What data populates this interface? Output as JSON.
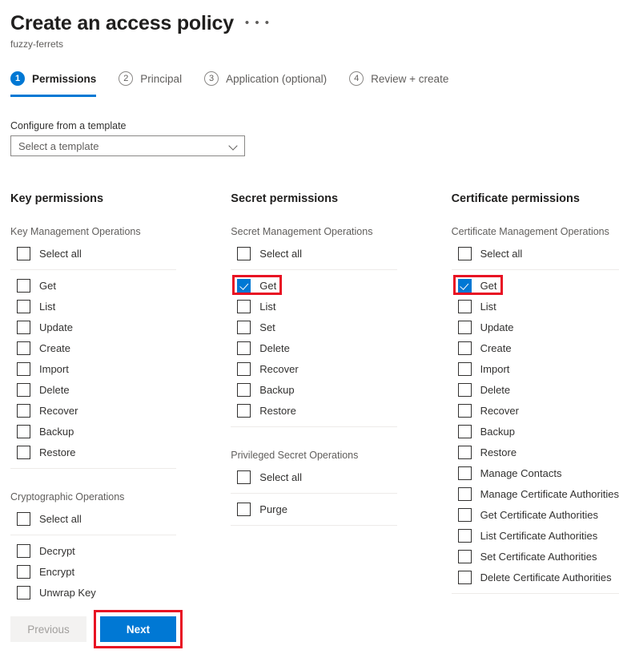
{
  "header": {
    "title": "Create an access policy",
    "subtitle": "fuzzy-ferrets",
    "more_menu": "• • •"
  },
  "tabs": [
    {
      "num": "1",
      "label": "Permissions",
      "active": true
    },
    {
      "num": "2",
      "label": "Principal",
      "active": false
    },
    {
      "num": "3",
      "label": "Application (optional)",
      "active": false
    },
    {
      "num": "4",
      "label": "Review + create",
      "active": false
    }
  ],
  "template": {
    "label": "Configure from a template",
    "selected": "Select a template",
    "chevron": "chevron-down-icon"
  },
  "columns": [
    {
      "title": "Key permissions",
      "groups": [
        {
          "title": "Key Management Operations",
          "select_all": "Select all",
          "items": [
            {
              "label": "Get",
              "checked": false,
              "highlight": false
            },
            {
              "label": "List",
              "checked": false,
              "highlight": false
            },
            {
              "label": "Update",
              "checked": false,
              "highlight": false
            },
            {
              "label": "Create",
              "checked": false,
              "highlight": false
            },
            {
              "label": "Import",
              "checked": false,
              "highlight": false
            },
            {
              "label": "Delete",
              "checked": false,
              "highlight": false
            },
            {
              "label": "Recover",
              "checked": false,
              "highlight": false
            },
            {
              "label": "Backup",
              "checked": false,
              "highlight": false
            },
            {
              "label": "Restore",
              "checked": false,
              "highlight": false
            }
          ]
        },
        {
          "title": "Cryptographic Operations",
          "select_all": "Select all",
          "items": [
            {
              "label": "Decrypt",
              "checked": false,
              "highlight": false
            },
            {
              "label": "Encrypt",
              "checked": false,
              "highlight": false
            },
            {
              "label": "Unwrap Key",
              "checked": false,
              "highlight": false
            }
          ]
        }
      ]
    },
    {
      "title": "Secret permissions",
      "groups": [
        {
          "title": "Secret Management Operations",
          "select_all": "Select all",
          "items": [
            {
              "label": "Get",
              "checked": true,
              "highlight": true
            },
            {
              "label": "List",
              "checked": false,
              "highlight": false
            },
            {
              "label": "Set",
              "checked": false,
              "highlight": false
            },
            {
              "label": "Delete",
              "checked": false,
              "highlight": false
            },
            {
              "label": "Recover",
              "checked": false,
              "highlight": false
            },
            {
              "label": "Backup",
              "checked": false,
              "highlight": false
            },
            {
              "label": "Restore",
              "checked": false,
              "highlight": false
            }
          ]
        },
        {
          "title": "Privileged Secret Operations",
          "select_all": "Select all",
          "items": [
            {
              "label": "Purge",
              "checked": false,
              "highlight": false
            }
          ]
        }
      ]
    },
    {
      "title": "Certificate permissions",
      "groups": [
        {
          "title": "Certificate Management Operations",
          "select_all": "Select all",
          "items": [
            {
              "label": "Get",
              "checked": true,
              "highlight": true
            },
            {
              "label": "List",
              "checked": false,
              "highlight": false
            },
            {
              "label": "Update",
              "checked": false,
              "highlight": false
            },
            {
              "label": "Create",
              "checked": false,
              "highlight": false
            },
            {
              "label": "Import",
              "checked": false,
              "highlight": false
            },
            {
              "label": "Delete",
              "checked": false,
              "highlight": false
            },
            {
              "label": "Recover",
              "checked": false,
              "highlight": false
            },
            {
              "label": "Backup",
              "checked": false,
              "highlight": false
            },
            {
              "label": "Restore",
              "checked": false,
              "highlight": false
            },
            {
              "label": "Manage Contacts",
              "checked": false,
              "highlight": false
            },
            {
              "label": "Manage Certificate Authorities",
              "checked": false,
              "highlight": false
            },
            {
              "label": "Get Certificate Authorities",
              "checked": false,
              "highlight": false
            },
            {
              "label": "List Certificate Authorities",
              "checked": false,
              "highlight": false
            },
            {
              "label": "Set Certificate Authorities",
              "checked": false,
              "highlight": false
            },
            {
              "label": "Delete Certificate Authorities",
              "checked": false,
              "highlight": false
            }
          ]
        }
      ]
    }
  ],
  "footer": {
    "previous_label": "Previous",
    "next_label": "Next"
  },
  "colors": {
    "accent": "#0078d4",
    "highlight": "#e81123",
    "text": "#323130",
    "muted": "#605e5c"
  }
}
